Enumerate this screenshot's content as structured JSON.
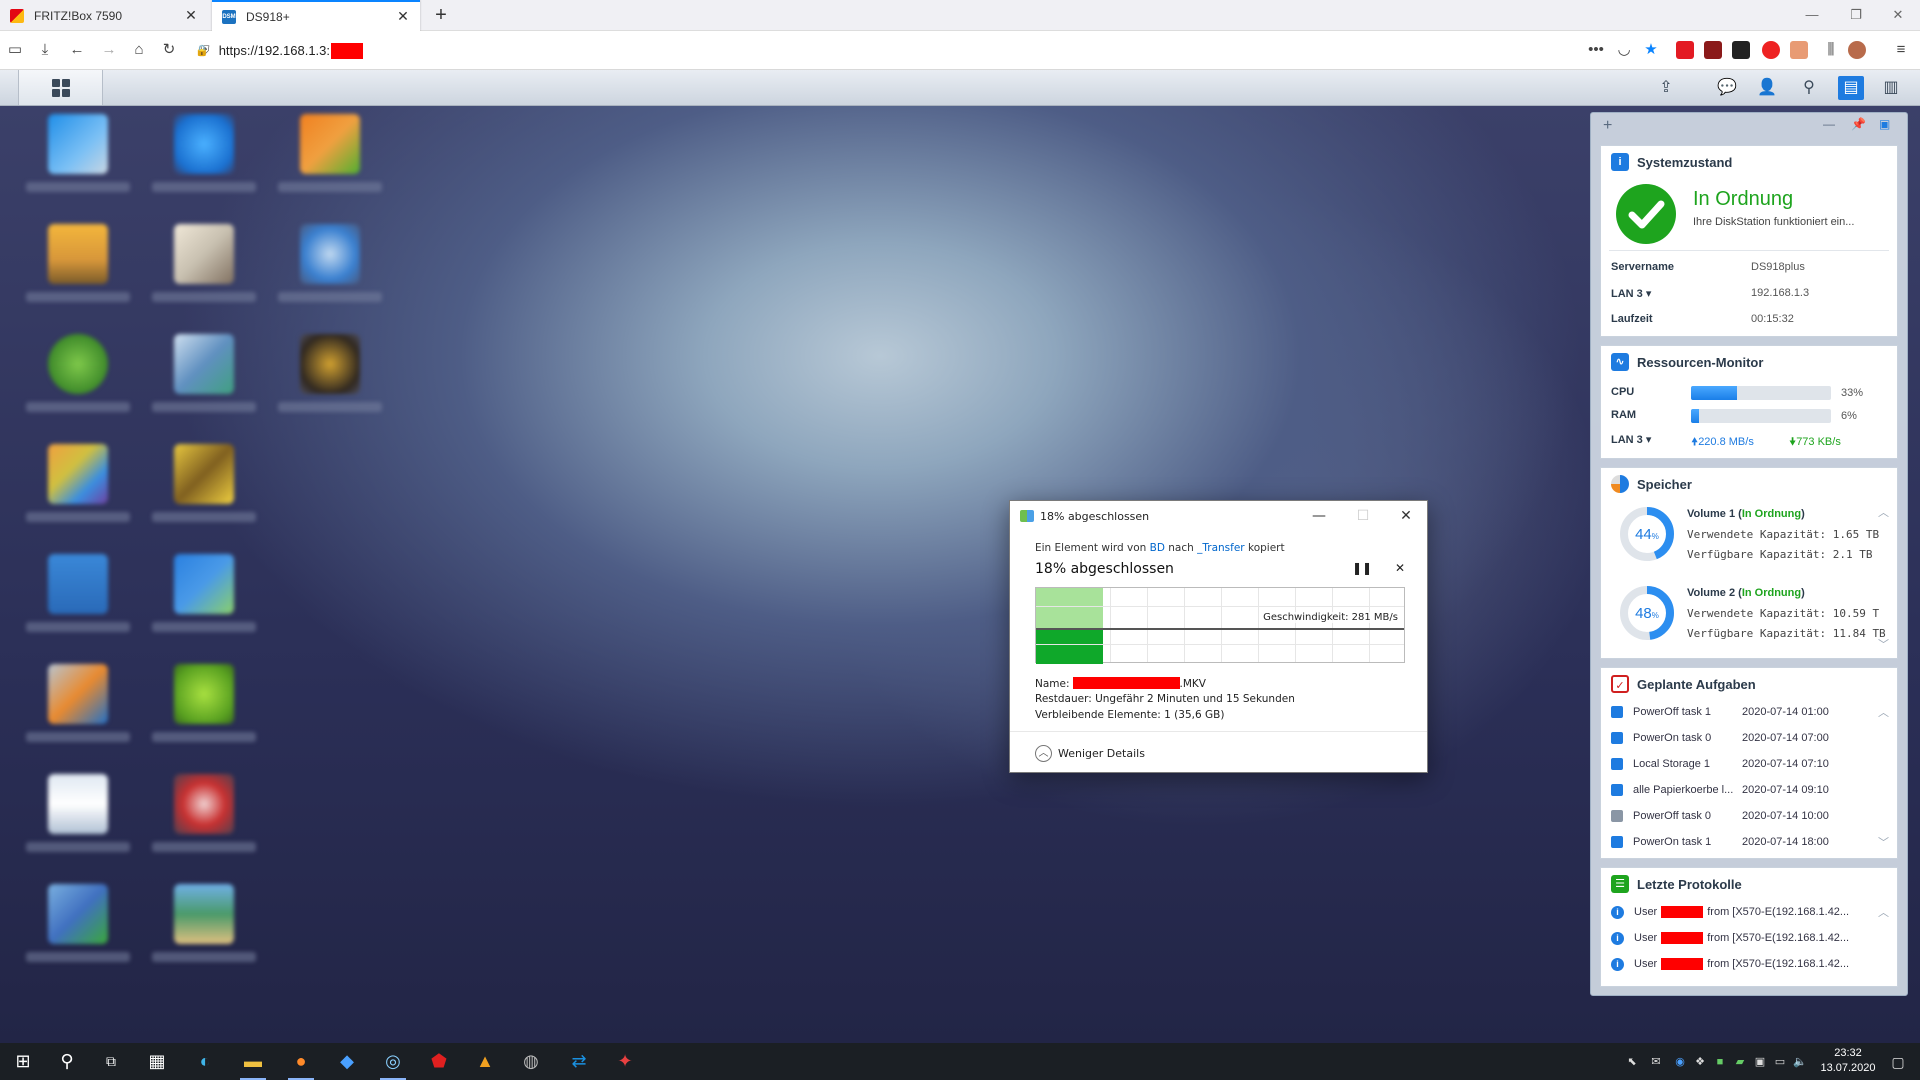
{
  "browser": {
    "tabs": [
      {
        "label": "FRITZ!Box 7590",
        "icon": "fritzbox-icon"
      },
      {
        "label": "DS918+",
        "icon": "dsm-icon"
      }
    ],
    "url": "https://192.168.1.3:"
  },
  "widgets": {
    "system": {
      "title": "Systemzustand",
      "status": "In Ordnung",
      "status_text": "Ihre DiskStation funktioniert ein...",
      "fields": [
        {
          "label": "Servername",
          "value": "DS918plus"
        },
        {
          "label": "LAN 3 ▾",
          "value": "192.168.1.3"
        },
        {
          "label": "Laufzeit",
          "value": "00:15:32"
        }
      ]
    },
    "resources": {
      "title": "Ressourcen-Monitor",
      "cpu_label": "CPU",
      "cpu_value": "33%",
      "cpu_fraction": 0.33,
      "ram_label": "RAM",
      "ram_value": "6%",
      "ram_fraction": 0.06,
      "lan_label": "LAN 3 ▾",
      "upload": "220.8 MB/s",
      "download": "773 KB/s"
    },
    "storage": {
      "title": "Speicher",
      "volumes": [
        {
          "name": "Volume 1",
          "status": "In Ordnung",
          "percent": "44",
          "fraction": 0.44,
          "used_label": "Verwendete Kapazität:",
          "used": "1.65 TB",
          "free_label": "Verfügbare Kapazität:",
          "free": "2.1 TB"
        },
        {
          "name": "Volume 2",
          "status": "In Ordnung",
          "percent": "48",
          "fraction": 0.48,
          "used_label": "Verwendete Kapazität:",
          "used": "10.59 T",
          "free_label": "Verfügbare Kapazität:",
          "free": "11.84 TB"
        }
      ]
    },
    "tasks": {
      "title": "Geplante Aufgaben",
      "items": [
        {
          "name": "PowerOff task 1",
          "time": "2020-07-14 01:00"
        },
        {
          "name": "PowerOn task 0",
          "time": "2020-07-14 07:00"
        },
        {
          "name": "Local Storage 1",
          "time": "2020-07-14 07:10"
        },
        {
          "name": "alle Papierkoerbe l...",
          "time": "2020-07-14 09:10"
        },
        {
          "name": "PowerOff task 0",
          "time": "2020-07-14 10:00"
        },
        {
          "name": "PowerOn task 1",
          "time": "2020-07-14 18:00"
        }
      ]
    },
    "logs": {
      "title": "Letzte Protokolle",
      "items": [
        {
          "prefix": "User",
          "suffix": "from [X570-E(192.168.1.42..."
        },
        {
          "prefix": "User",
          "suffix": "from [X570-E(192.168.1.42..."
        },
        {
          "prefix": "User",
          "suffix": "from [X570-E(192.168.1.42..."
        }
      ]
    }
  },
  "copy_dialog": {
    "title": "18% abgeschlossen",
    "desc_prefix": "Ein Element wird von",
    "source": "BD",
    "desc_mid": "nach",
    "target": "_Transfer",
    "desc_suffix": "kopiert",
    "heading": "18% abgeschlossen",
    "progress_fraction": 0.18,
    "speed": "Geschwindigkeit: 281 MB/s",
    "name_label": "Name:",
    "name_ext": ".MKV",
    "remaining": "Restdauer: Ungefähr 2 Minuten und 15 Sekunden",
    "items_left": "Verbleibende Elemente: 1 (35,6 GB)",
    "less_details": "Weniger Details"
  },
  "taskbar": {
    "time": "23:32",
    "date": "13.07.2020"
  },
  "colors": {
    "ok_green": "#1ea41e",
    "accent_blue": "#1e7be0",
    "redaction": "#ff0000"
  }
}
